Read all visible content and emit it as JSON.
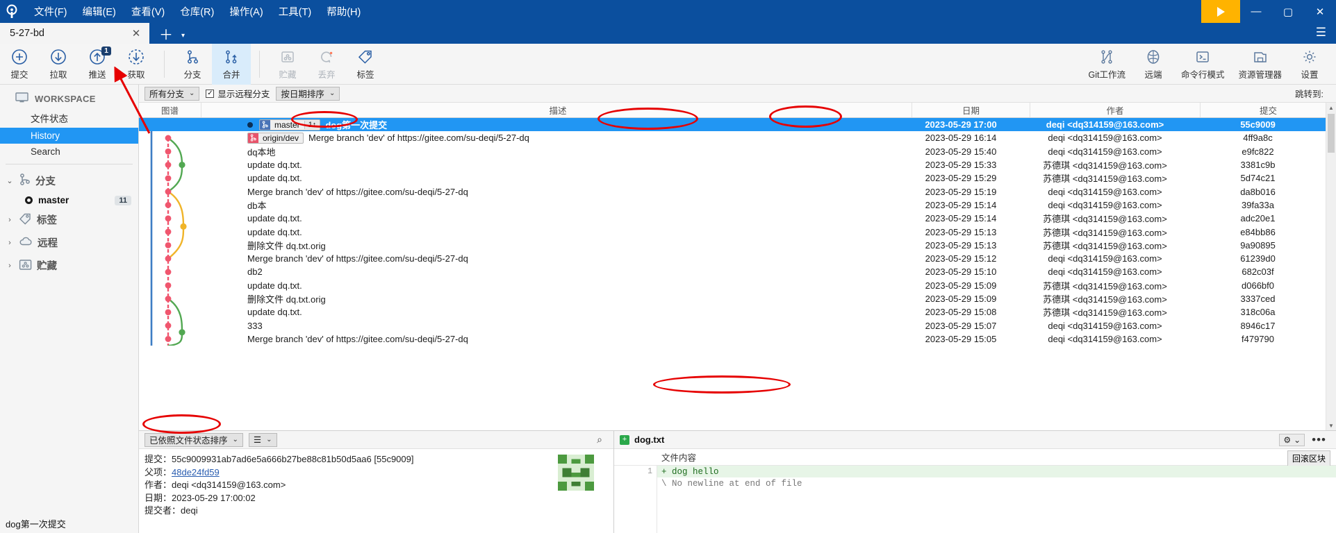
{
  "window": {
    "menu": [
      "文件(F)",
      "编辑(E)",
      "查看(V)",
      "仓库(R)",
      "操作(A)",
      "工具(T)",
      "帮助(H)"
    ],
    "tab_title": "5-27-bd",
    "tab_close": "✕",
    "tab_add": "＋",
    "tab_caret": "▾",
    "hamburger": "☰",
    "minimize": "—",
    "maximize": "▢",
    "close": "✕"
  },
  "toolbar": {
    "left": [
      {
        "label": "提交",
        "icon": "plus-circle-icon",
        "badge": "",
        "state": "normal"
      },
      {
        "label": "拉取",
        "icon": "arrow-down-circle-icon",
        "badge": "",
        "state": "normal"
      },
      {
        "label": "推送",
        "icon": "arrow-up-circle-icon",
        "badge": "1",
        "state": "normal"
      },
      {
        "label": "获取",
        "icon": "arrow-down-dashed-circle-icon",
        "badge": "",
        "state": "normal"
      },
      {
        "label": "分支",
        "icon": "branch-icon",
        "badge": "",
        "state": "normal"
      },
      {
        "label": "合并",
        "icon": "merge-icon",
        "badge": "",
        "state": "active"
      },
      {
        "label": "贮藏",
        "icon": "stash-icon",
        "badge": "",
        "state": "disabled"
      },
      {
        "label": "丢弃",
        "icon": "discard-icon",
        "badge": "",
        "state": "disabled"
      },
      {
        "label": "标签",
        "icon": "tag-icon",
        "badge": "",
        "state": "normal"
      }
    ],
    "right": [
      {
        "label": "Git工作流",
        "icon": "gitflow-icon"
      },
      {
        "label": "远端",
        "icon": "globe-icon"
      },
      {
        "label": "命令行模式",
        "icon": "terminal-icon"
      },
      {
        "label": "资源管理器",
        "icon": "explorer-icon"
      },
      {
        "label": "设置",
        "icon": "gear-icon"
      }
    ]
  },
  "sidebar": {
    "workspace_label": "WORKSPACE",
    "items": [
      {
        "label": "文件状态",
        "selected": false
      },
      {
        "label": "History",
        "selected": true
      },
      {
        "label": "Search",
        "selected": false
      }
    ],
    "nodes": [
      {
        "label": "分支",
        "icon": "branch-icon",
        "expanded": true,
        "twisty": "⌄"
      },
      {
        "label": "标签",
        "icon": "tag-icon",
        "expanded": false,
        "twisty": "›"
      },
      {
        "label": "远程",
        "icon": "cloud-icon",
        "expanded": false,
        "twisty": "›"
      },
      {
        "label": "贮藏",
        "icon": "stash-icon",
        "expanded": false,
        "twisty": "›"
      }
    ],
    "branch_child": {
      "label": "master",
      "count": "11"
    }
  },
  "filterbar": {
    "branch_filter": "所有分支",
    "show_remote_label": "显示远程分支",
    "show_remote_checked": true,
    "sort_by": "按日期排序",
    "goto_label": "跳转到:"
  },
  "table": {
    "headers": [
      "图谱",
      "描述",
      "日期",
      "作者",
      "提交"
    ],
    "rows": [
      {
        "tags": [
          {
            "name": "master",
            "type": "local",
            "count": "1↑"
          }
        ],
        "desc": "dog第一次提交",
        "date": "2023-05-29 17:00",
        "author": "deqi <dq314159@163.com>",
        "hash": "55c9009",
        "selected": true,
        "head": true
      },
      {
        "tags": [
          {
            "name": "origin/dev",
            "type": "remote",
            "count": ""
          }
        ],
        "desc": "Merge branch 'dev' of https://gitee.com/su-deqi/5-27-dq",
        "date": "2023-05-29 16:14",
        "author": "deqi <dq314159@163.com>",
        "hash": "4ff9a8c",
        "selected": false
      },
      {
        "tags": [],
        "desc": "dq本地",
        "date": "2023-05-29 15:40",
        "author": "deqi <dq314159@163.com>",
        "hash": "e9fc822",
        "selected": false
      },
      {
        "tags": [],
        "desc": "update dq.txt.",
        "date": "2023-05-29 15:33",
        "author": "苏德琪 <dq314159@163.com>",
        "hash": "3381c9b",
        "selected": false
      },
      {
        "tags": [],
        "desc": "update dq.txt.",
        "date": "2023-05-29 15:29",
        "author": "苏德琪 <dq314159@163.com>",
        "hash": "5d74c21",
        "selected": false
      },
      {
        "tags": [],
        "desc": "Merge branch 'dev' of https://gitee.com/su-deqi/5-27-dq",
        "date": "2023-05-29 15:19",
        "author": "deqi <dq314159@163.com>",
        "hash": "da8b016",
        "selected": false
      },
      {
        "tags": [],
        "desc": "db本",
        "date": "2023-05-29 15:14",
        "author": "deqi <dq314159@163.com>",
        "hash": "39fa33a",
        "selected": false
      },
      {
        "tags": [],
        "desc": "update dq.txt.",
        "date": "2023-05-29 15:14",
        "author": "苏德琪 <dq314159@163.com>",
        "hash": "adc20e1",
        "selected": false
      },
      {
        "tags": [],
        "desc": "update dq.txt.",
        "date": "2023-05-29 15:13",
        "author": "苏德琪 <dq314159@163.com>",
        "hash": "e84bb86",
        "selected": false
      },
      {
        "tags": [],
        "desc": "删除文件 dq.txt.orig",
        "date": "2023-05-29 15:13",
        "author": "苏德琪 <dq314159@163.com>",
        "hash": "9a90895",
        "selected": false
      },
      {
        "tags": [],
        "desc": "Merge branch 'dev' of https://gitee.com/su-deqi/5-27-dq",
        "date": "2023-05-29 15:12",
        "author": "deqi <dq314159@163.com>",
        "hash": "61239d0",
        "selected": false
      },
      {
        "tags": [],
        "desc": "db2",
        "date": "2023-05-29 15:10",
        "author": "deqi <dq314159@163.com>",
        "hash": "682c03f",
        "selected": false
      },
      {
        "tags": [],
        "desc": "update dq.txt.",
        "date": "2023-05-29 15:09",
        "author": "苏德琪 <dq314159@163.com>",
        "hash": "d066bf0",
        "selected": false
      },
      {
        "tags": [],
        "desc": "删除文件 dq.txt.orig",
        "date": "2023-05-29 15:09",
        "author": "苏德琪 <dq314159@163.com>",
        "hash": "3337ced",
        "selected": false
      },
      {
        "tags": [],
        "desc": "update dq.txt.",
        "date": "2023-05-29 15:08",
        "author": "苏德琪 <dq314159@163.com>",
        "hash": "318c06a",
        "selected": false
      },
      {
        "tags": [],
        "desc": "333",
        "date": "2023-05-29 15:07",
        "author": "deqi <dq314159@163.com>",
        "hash": "8946c17",
        "selected": false
      },
      {
        "tags": [],
        "desc": "Merge branch 'dev' of https://gitee.com/su-deqi/5-27-dq",
        "date": "2023-05-29 15:05",
        "author": "deqi <dq314159@163.com>",
        "hash": "f479790",
        "selected": false
      }
    ]
  },
  "detail_panel": {
    "sort_combo": "已依照文件状态排序",
    "list_icon": "☰",
    "search_icon": "⌕",
    "lines": [
      {
        "key": "提交：",
        "value": "55c9009931ab7ad6e5a666b27be88c81b50d5aa6 [55c9009]",
        "link": false
      },
      {
        "key": "父项：",
        "value": "48de24fd59",
        "link": true
      },
      {
        "key": "作者：",
        "value": "deqi <dq314159@163.com>",
        "link": false
      },
      {
        "key": "日期：",
        "value": "2023-05-29 17:00:02",
        "link": false
      },
      {
        "key": "提交者：",
        "value": "deqi",
        "link": false
      }
    ],
    "message": "dog第一次提交"
  },
  "diff_panel": {
    "file_name": "dog.txt",
    "file_status_icon": "+",
    "gear_icon": "⚙",
    "gear_caret": "⌄",
    "more_icon": "•••",
    "content_label": "文件内容",
    "rollback_label": "回滚区块",
    "lines": [
      {
        "num": "1",
        "text": "+ dog hello",
        "type": "add"
      },
      {
        "num": "",
        "text": "\\ No newline at end of file",
        "type": "meta"
      }
    ]
  },
  "colors": {
    "titlebar": "#0b4f9e",
    "selection": "#2196f3",
    "accent_yellow": "#ffb300",
    "graph_red": "#f0566e",
    "graph_blue": "#3d7dc4",
    "graph_green": "#52a852",
    "graph_yellow": "#f0b429",
    "annotation": "#e60000",
    "add_line": "#e7f5e7"
  }
}
